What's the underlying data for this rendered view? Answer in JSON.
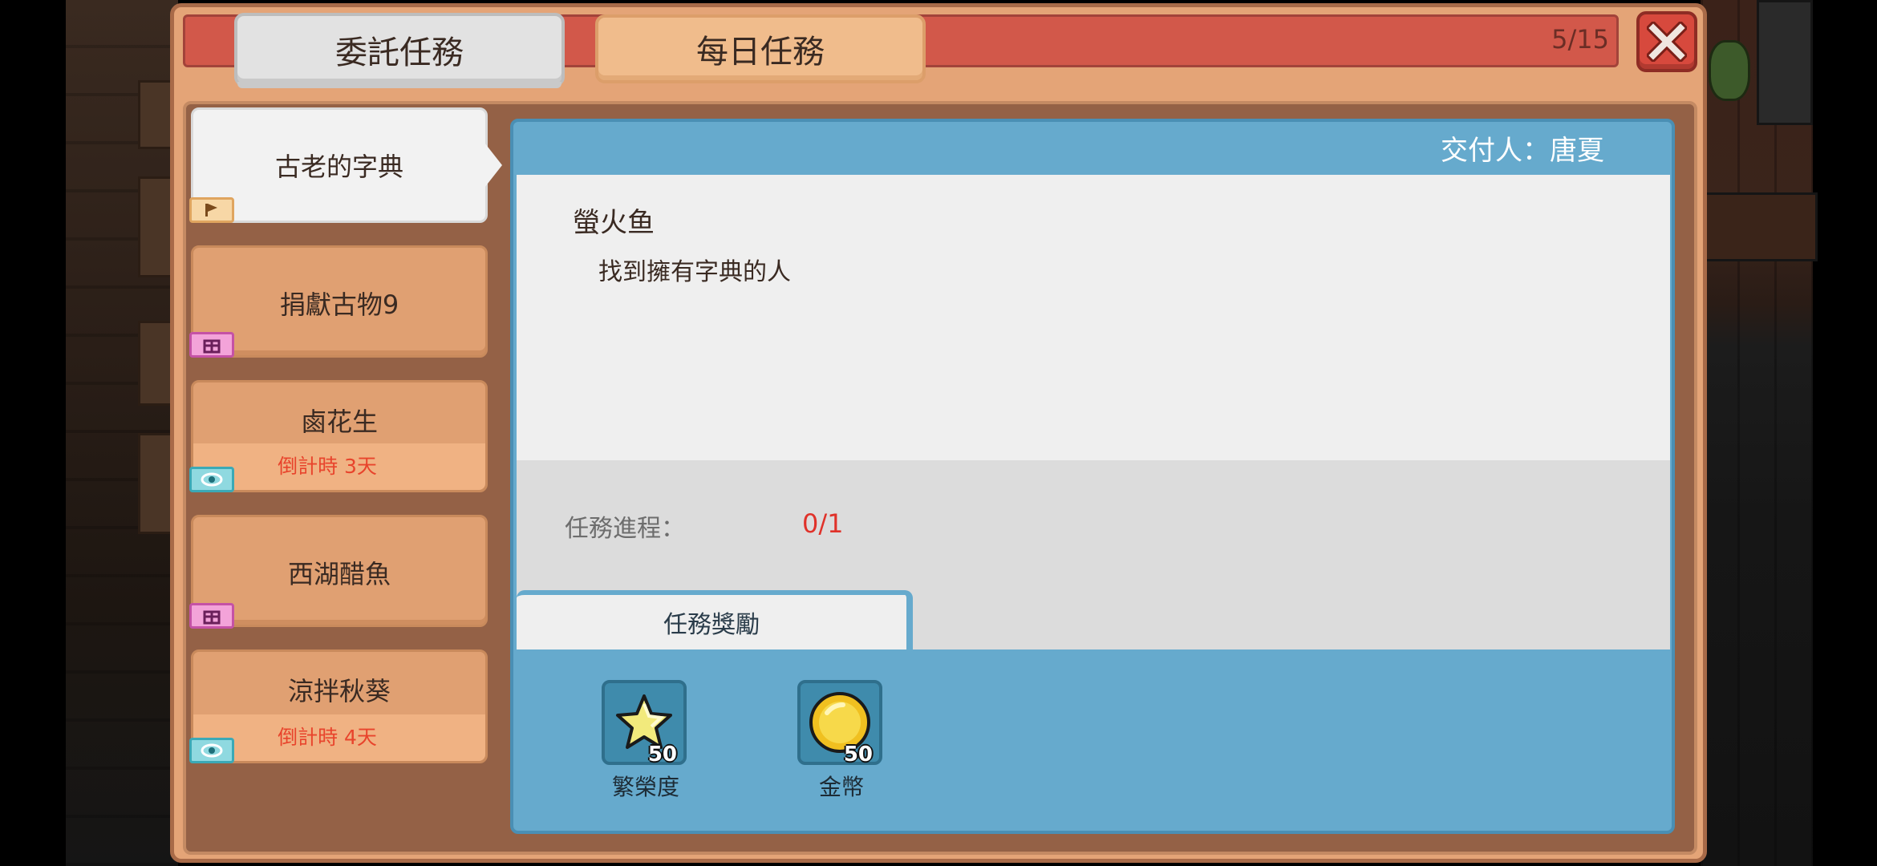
{
  "tabs": {
    "commission": "委託任務",
    "daily": "每日任務"
  },
  "counter": "5/15",
  "quests": [
    {
      "title": "古老的字典",
      "tag": "flag-icon",
      "countdown": ""
    },
    {
      "title": "捐獻古物9",
      "tag": "gift-icon",
      "countdown": ""
    },
    {
      "title": "鹵花生",
      "tag": "eye-icon",
      "countdown": "倒計時 3天"
    },
    {
      "title": "西湖醋魚",
      "tag": "gift-icon",
      "countdown": ""
    },
    {
      "title": "涼拌秋葵",
      "tag": "eye-icon",
      "countdown": "倒計時 4天"
    }
  ],
  "detail": {
    "giver": "交付人：唐夏",
    "title": "螢火鱼",
    "description": "找到擁有字典的人",
    "progress_label": "任務進程：",
    "progress_value": "0/1",
    "reward_tab": "任務獎勵",
    "rewards": [
      {
        "name": "繁榮度",
        "qty": "50",
        "icon": "star-icon"
      },
      {
        "name": "金幣",
        "qty": "50",
        "icon": "gold-coin-icon"
      }
    ]
  },
  "colors": {
    "top_bar": "#d2584a",
    "frame": "#e4a477",
    "detail": "#66aacd",
    "countdown_text": "#e8442c",
    "progress_value": "#e0322a"
  }
}
